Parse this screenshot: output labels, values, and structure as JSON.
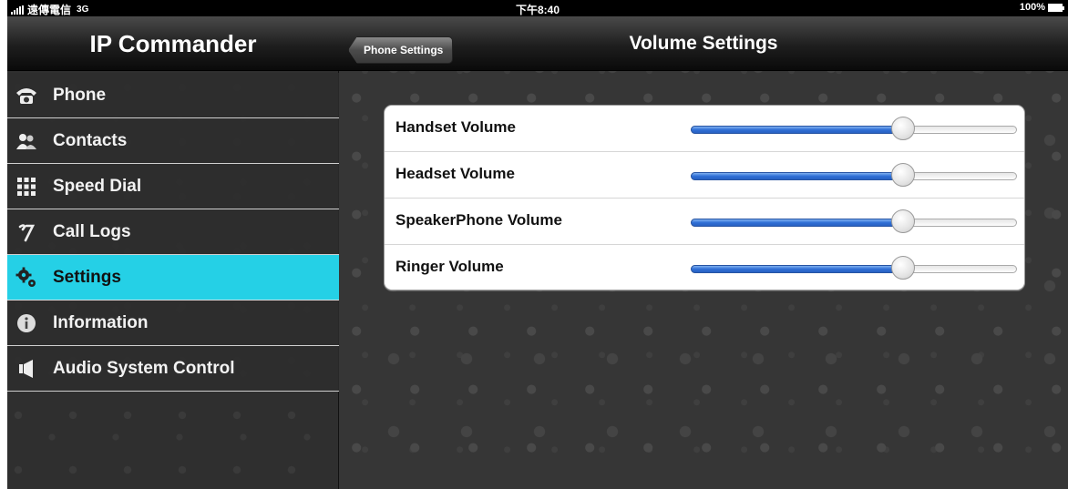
{
  "status_bar": {
    "carrier": "遠傳電信",
    "network": "3G",
    "time": "下午8:40",
    "battery": "100%"
  },
  "sidebar": {
    "title": "IP Commander",
    "items": [
      {
        "label": "Phone",
        "icon": "telephone-icon",
        "active": false
      },
      {
        "label": "Contacts",
        "icon": "people-icon",
        "active": false
      },
      {
        "label": "Speed Dial",
        "icon": "keypad-grid-icon",
        "active": false
      },
      {
        "label": "Call Logs",
        "icon": "call-log-icon",
        "active": false
      },
      {
        "label": "Settings",
        "icon": "gears-icon",
        "active": true
      },
      {
        "label": "Information",
        "icon": "info-icon",
        "active": false
      },
      {
        "label": "Audio System Control",
        "icon": "speaker-icon",
        "active": false
      }
    ],
    "active_color": "#25d0e6"
  },
  "nav_bar": {
    "title": "Volume Settings",
    "back_label": "Phone Settings"
  },
  "volume_settings": [
    {
      "label": "Handset Volume",
      "level": 0.65
    },
    {
      "label": "Headset Volume",
      "level": 0.65
    },
    {
      "label": "SpeakerPhone Volume",
      "level": 0.65
    },
    {
      "label": "Ringer Volume",
      "level": 0.65
    }
  ],
  "colors": {
    "slider_fill": "#2f6fd6",
    "selected_row": "#25d0e6"
  }
}
